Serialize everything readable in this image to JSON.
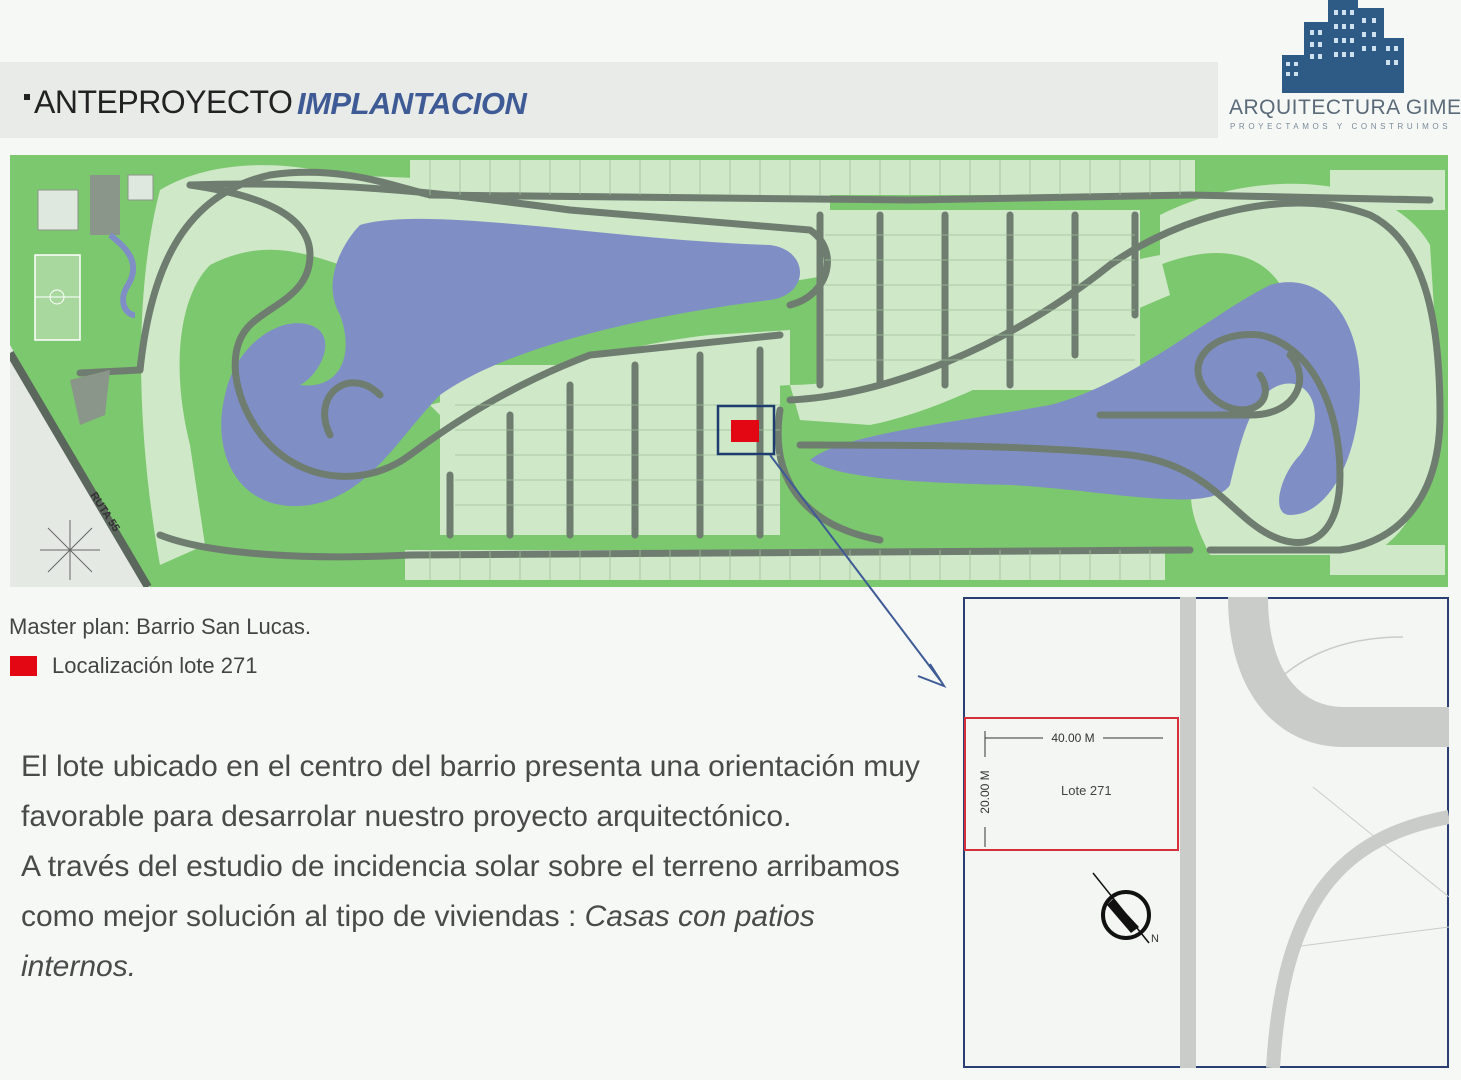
{
  "header": {
    "section": "ANTEPROYECTO",
    "subsection": "IMPLANTACION"
  },
  "logo": {
    "name": "ARQUITECTURA GIMENEZ",
    "tagline": "PROYECTAMOS Y CONSTRUIMOS"
  },
  "plan": {
    "road_label": "RUTA 55"
  },
  "caption": "Master plan: Barrio San Lucas.",
  "legend": {
    "label": "Localización lote 271",
    "color": "#e30613"
  },
  "description": {
    "line1": "El lote ubicado en el centro del barrio presenta una orientación muy",
    "line2": "favorable para desarrolar nuestro proyecto arquitectónico.",
    "line3": "A través del estudio de incidencia solar sobre el terreno arribamos",
    "line4_prefix": "como mejor solución al tipo de viviendas : ",
    "line4_emphasis": "Casas con patios internos."
  },
  "detail": {
    "width_dimension": "40.00 M",
    "depth_dimension": "20.00 M",
    "lot_label": "Lote 271",
    "north_label": "N"
  },
  "colors": {
    "lot_green": "#cfe8c8",
    "grass_green": "#7cc86e",
    "road_gray": "#6f7d70",
    "lake_blue": "#7f8fc6",
    "accent_blue": "#3f5b95",
    "lot_highlight": "#e30613"
  }
}
